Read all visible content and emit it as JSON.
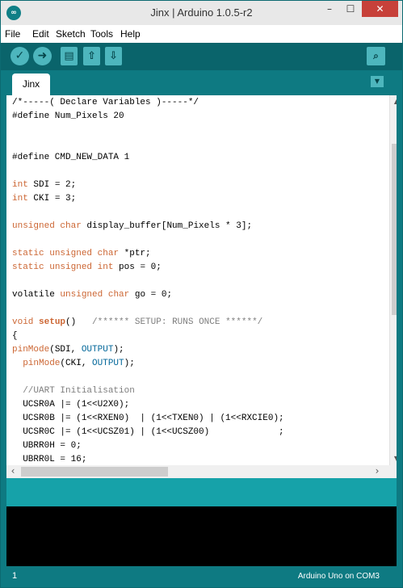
{
  "window": {
    "title": "Jinx | Arduino 1.0.5-r2",
    "app_icon": "arduino-icon",
    "controls": {
      "minimize": "–",
      "maximize": "☐",
      "close": "✕"
    }
  },
  "menu": {
    "items": [
      "File",
      "Edit",
      "Sketch",
      "Tools",
      "Help"
    ]
  },
  "toolbar": {
    "buttons": [
      {
        "name": "verify",
        "icon": "checkmark-icon",
        "glyph": "✓"
      },
      {
        "name": "upload",
        "icon": "arrow-right-icon",
        "glyph": "➜"
      },
      {
        "name": "new",
        "icon": "document-icon",
        "glyph": "▤"
      },
      {
        "name": "open",
        "icon": "arrow-up-icon",
        "glyph": "⇧"
      },
      {
        "name": "save",
        "icon": "arrow-down-icon",
        "glyph": "⇩"
      }
    ],
    "serial_monitor": {
      "icon": "magnifier-icon",
      "glyph": "⌕"
    }
  },
  "tabs": {
    "active": "Jinx",
    "menu_glyph": "▼"
  },
  "editor": {
    "lines": [
      [
        {
          "t": "/*-----( Declare Variables )-----*/",
          "c": "plain"
        }
      ],
      [
        {
          "t": "#define Num_Pixels 20",
          "c": "plain"
        }
      ],
      [
        {
          "t": "",
          "c": "plain"
        }
      ],
      [
        {
          "t": "",
          "c": "plain"
        }
      ],
      [
        {
          "t": "#define CMD_NEW_DATA 1",
          "c": "plain"
        }
      ],
      [
        {
          "t": "",
          "c": "plain"
        }
      ],
      [
        {
          "t": "int",
          "c": "kw"
        },
        {
          "t": " SDI = 2;",
          "c": "plain"
        }
      ],
      [
        {
          "t": "int",
          "c": "kw"
        },
        {
          "t": " CKI = 3;",
          "c": "plain"
        }
      ],
      [
        {
          "t": "",
          "c": "plain"
        }
      ],
      [
        {
          "t": "unsigned",
          "c": "kw"
        },
        {
          "t": " ",
          "c": "plain"
        },
        {
          "t": "char",
          "c": "kw"
        },
        {
          "t": " display_buffer[Num_Pixels * 3];",
          "c": "plain"
        }
      ],
      [
        {
          "t": "",
          "c": "plain"
        }
      ],
      [
        {
          "t": "static",
          "c": "kw"
        },
        {
          "t": " ",
          "c": "plain"
        },
        {
          "t": "unsigned",
          "c": "kw"
        },
        {
          "t": " ",
          "c": "plain"
        },
        {
          "t": "char",
          "c": "kw"
        },
        {
          "t": " *ptr;",
          "c": "plain"
        }
      ],
      [
        {
          "t": "static",
          "c": "kw"
        },
        {
          "t": " ",
          "c": "plain"
        },
        {
          "t": "unsigned",
          "c": "kw"
        },
        {
          "t": " ",
          "c": "plain"
        },
        {
          "t": "int",
          "c": "kw"
        },
        {
          "t": " pos = 0;",
          "c": "plain"
        }
      ],
      [
        {
          "t": "",
          "c": "plain"
        }
      ],
      [
        {
          "t": "volatile ",
          "c": "plain"
        },
        {
          "t": "unsigned",
          "c": "kw"
        },
        {
          "t": " ",
          "c": "plain"
        },
        {
          "t": "char",
          "c": "kw"
        },
        {
          "t": " go = 0;",
          "c": "plain"
        }
      ],
      [
        {
          "t": "",
          "c": "plain"
        }
      ],
      [
        {
          "t": "void",
          "c": "kw"
        },
        {
          "t": " ",
          "c": "plain"
        },
        {
          "t": "setup",
          "c": "fn"
        },
        {
          "t": "()   ",
          "c": "plain"
        },
        {
          "t": "/****** SETUP: RUNS ONCE ******/",
          "c": "cm"
        }
      ],
      [
        {
          "t": "{",
          "c": "plain"
        }
      ],
      [
        {
          "t": "pinMode",
          "c": "kw"
        },
        {
          "t": "(SDI, ",
          "c": "plain"
        },
        {
          "t": "OUTPUT",
          "c": "cst"
        },
        {
          "t": ");",
          "c": "plain"
        }
      ],
      [
        {
          "t": "  ",
          "c": "plain"
        },
        {
          "t": "pinMode",
          "c": "kw"
        },
        {
          "t": "(CKI, ",
          "c": "plain"
        },
        {
          "t": "OUTPUT",
          "c": "cst"
        },
        {
          "t": ");",
          "c": "plain"
        }
      ],
      [
        {
          "t": "",
          "c": "plain"
        }
      ],
      [
        {
          "t": "  ",
          "c": "plain"
        },
        {
          "t": "//UART Initialisation",
          "c": "cm"
        }
      ],
      [
        {
          "t": "  UCSR0A |= (1<<U2X0);",
          "c": "plain"
        }
      ],
      [
        {
          "t": "  UCSR0B |= (1<<RXEN0)  | (1<<TXEN0) | (1<<RXCIE0);",
          "c": "plain"
        }
      ],
      [
        {
          "t": "  UCSR0C |= (1<<UCSZ01) | (1<<UCSZ00)             ;",
          "c": "plain"
        }
      ],
      [
        {
          "t": "  UBRR0H = 0;",
          "c": "plain"
        }
      ],
      [
        {
          "t": "  UBRR0L = 16;",
          "c": "plain"
        }
      ]
    ]
  },
  "scrollbars": {
    "up": "▲",
    "down": "▼",
    "left": "‹",
    "right": "›"
  },
  "status": {
    "line": "1",
    "board": "Arduino Uno on COM3"
  },
  "colors": {
    "toolbar": "#0a646b",
    "tabbar": "#0e7a82",
    "statusbar": "#16a2a9",
    "keyword": "#cc6633",
    "constant": "#006699",
    "comment": "#7e7e7e"
  }
}
